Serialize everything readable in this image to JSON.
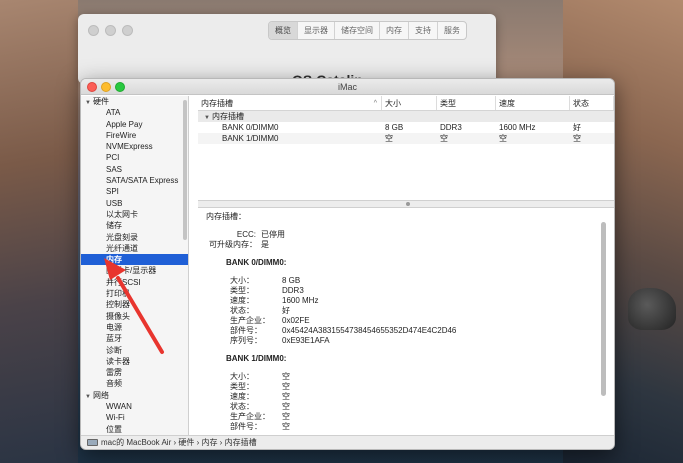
{
  "back_window": {
    "tabs": [
      "概览",
      "显示器",
      "储存空间",
      "内存",
      "支持",
      "服务"
    ],
    "selected_tab": 0,
    "partial_title": "OS Catalin"
  },
  "window": {
    "title": "iMac"
  },
  "sidebar": {
    "items": [
      {
        "label": "硬件",
        "type": "category",
        "expanded": true
      },
      {
        "label": "ATA",
        "type": "sub"
      },
      {
        "label": "Apple Pay",
        "type": "sub"
      },
      {
        "label": "FireWire",
        "type": "sub"
      },
      {
        "label": "NVMExpress",
        "type": "sub"
      },
      {
        "label": "PCI",
        "type": "sub"
      },
      {
        "label": "SAS",
        "type": "sub"
      },
      {
        "label": "SATA/SATA Express",
        "type": "sub"
      },
      {
        "label": "SPI",
        "type": "sub"
      },
      {
        "label": "USB",
        "type": "sub"
      },
      {
        "label": "以太网卡",
        "type": "sub"
      },
      {
        "label": "储存",
        "type": "sub"
      },
      {
        "label": "光盘刻录",
        "type": "sub"
      },
      {
        "label": "光纤通道",
        "type": "sub"
      },
      {
        "label": "内存",
        "type": "sub",
        "selected": true
      },
      {
        "label": "图形卡/显示器",
        "type": "sub"
      },
      {
        "label": "并行SCSI",
        "type": "sub"
      },
      {
        "label": "打印机",
        "type": "sub"
      },
      {
        "label": "控制器",
        "type": "sub"
      },
      {
        "label": "摄像头",
        "type": "sub"
      },
      {
        "label": "电源",
        "type": "sub"
      },
      {
        "label": "蓝牙",
        "type": "sub"
      },
      {
        "label": "诊断",
        "type": "sub"
      },
      {
        "label": "读卡器",
        "type": "sub"
      },
      {
        "label": "雷雳",
        "type": "sub"
      },
      {
        "label": "音频",
        "type": "sub"
      },
      {
        "label": "网络",
        "type": "category",
        "expanded": true
      },
      {
        "label": "WWAN",
        "type": "sub"
      },
      {
        "label": "Wi-Fi",
        "type": "sub"
      },
      {
        "label": "位置",
        "type": "sub"
      }
    ]
  },
  "table": {
    "headers": [
      "内存插槽",
      "大小",
      "类型",
      "速度",
      "状态"
    ],
    "group": "内存插槽",
    "rows": [
      [
        "BANK 0/DIMM0",
        "8 GB",
        "DDR3",
        "1600 MHz",
        "好"
      ],
      [
        "BANK 1/DIMM0",
        "空",
        "空",
        "空",
        "空"
      ]
    ]
  },
  "detail": {
    "heading": "内存插槽：",
    "ecc_label": "ECC:",
    "ecc_value": "已停用",
    "upgrade_label": "可升级内存：",
    "upgrade_value": "是",
    "banks": [
      {
        "name": "BANK 0/DIMM0:",
        "fields": [
          {
            "k": "大小：",
            "v": "8 GB"
          },
          {
            "k": "类型：",
            "v": "DDR3"
          },
          {
            "k": "速度：",
            "v": "1600 MHz"
          },
          {
            "k": "状态：",
            "v": "好"
          },
          {
            "k": "生产企业：",
            "v": "0x02FE"
          },
          {
            "k": "部件号：",
            "v": "0x45424A3831554738454655352D474E4C2D46"
          },
          {
            "k": "序列号：",
            "v": "0xE93E1AFA"
          }
        ]
      },
      {
        "name": "BANK 1/DIMM0:",
        "fields": [
          {
            "k": "大小：",
            "v": "空"
          },
          {
            "k": "类型：",
            "v": "空"
          },
          {
            "k": "速度：",
            "v": "空"
          },
          {
            "k": "状态：",
            "v": "空"
          },
          {
            "k": "生产企业：",
            "v": "空"
          },
          {
            "k": "部件号：",
            "v": "空"
          }
        ]
      }
    ]
  },
  "statusbar": {
    "path": "mac的 MacBook Air › 硬件 › 内存 › 内存插槽"
  },
  "colors": {
    "selection": "#1f5fd6",
    "arrow": "#e8352e"
  }
}
